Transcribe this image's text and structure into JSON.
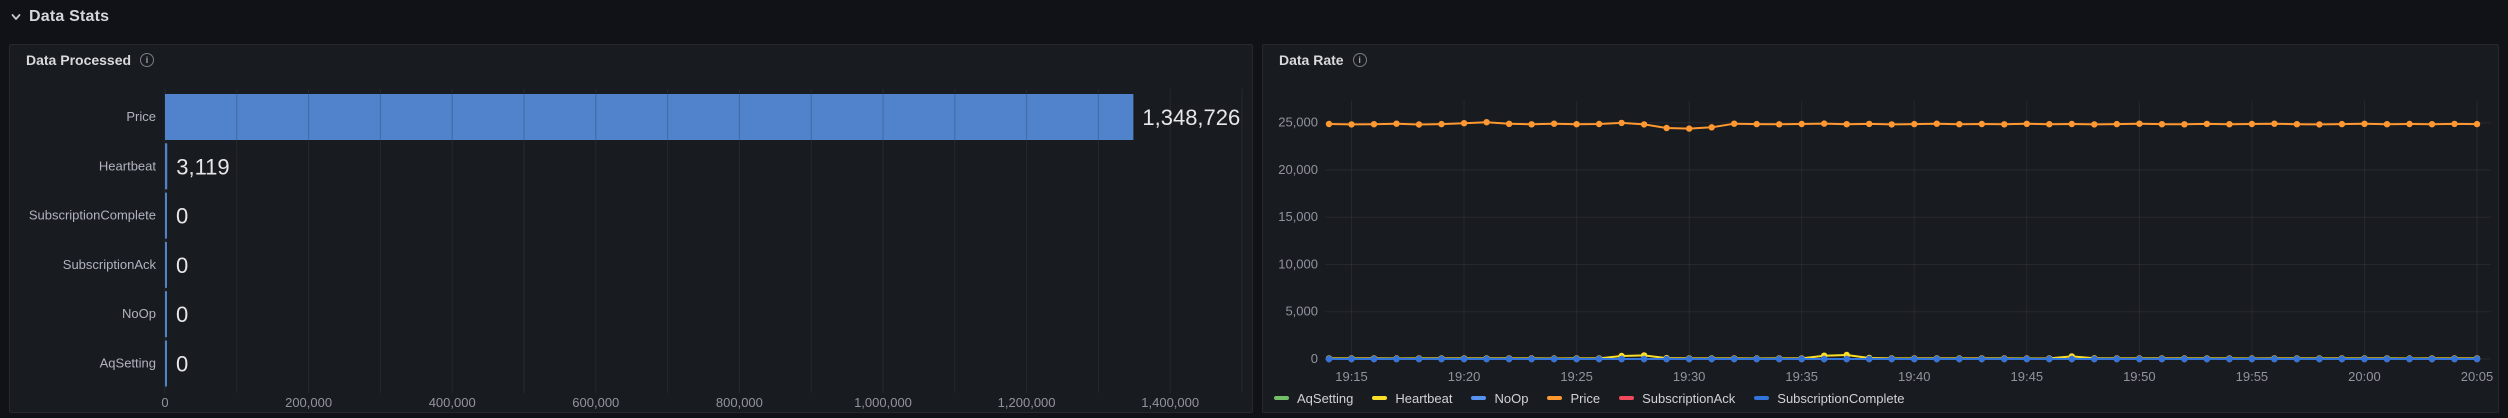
{
  "row_header": {
    "title": "Data Stats"
  },
  "panels": {
    "data_processed": {
      "title": "Data Processed"
    },
    "data_rate": {
      "title": "Data Rate"
    }
  },
  "colors": {
    "page_background": "#111217",
    "panel_background": "#181b1f",
    "panel_border": "#26282e",
    "grid_line": "rgba(204,204,220,0.08)",
    "axis_text": "rgba(204,204,220,0.68)",
    "bar_blue": "#5083cb",
    "value_label": "#e6e7e9"
  },
  "chart_data": [
    {
      "type": "bar",
      "orientation": "horizontal",
      "title": "Data Processed",
      "categories": [
        "Price",
        "Heartbeat",
        "SubscriptionComplete",
        "SubscriptionAck",
        "NoOp",
        "AqSetting"
      ],
      "values": [
        1348726,
        3119,
        0,
        0,
        0,
        0
      ],
      "value_labels": [
        "1,348,726",
        "3,119",
        "0",
        "0",
        "0",
        "0"
      ],
      "bar_color": "#5083cb",
      "xlim": [
        0,
        1500000
      ],
      "grid_step": 100000,
      "x_tick_values": [
        0,
        200000,
        400000,
        600000,
        800000,
        1000000,
        1200000,
        1400000
      ],
      "x_tick_labels": [
        "0",
        "200,000",
        "400,000",
        "600,000",
        "800,000",
        "1,000,000",
        "1,200,000",
        "1,400,000"
      ],
      "legend": "none"
    },
    {
      "type": "line",
      "title": "Data Rate",
      "points_per_series": 52,
      "x_start": "19:14",
      "x_end": "20:05",
      "x_tick_labels": [
        "19:15",
        "19:20",
        "19:25",
        "19:30",
        "19:35",
        "19:40",
        "19:45",
        "19:50",
        "19:55",
        "20:00",
        "20:05"
      ],
      "x_tick_indices": [
        1,
        6,
        11,
        16,
        21,
        26,
        31,
        36,
        41,
        46,
        51
      ],
      "y_tick_values": [
        0,
        5000,
        10000,
        15000,
        20000,
        25000
      ],
      "y_tick_labels": [
        "0",
        "5,000",
        "10,000",
        "15,000",
        "20,000",
        "25,000"
      ],
      "ylim": [
        0,
        27300
      ],
      "legend_position": "bottom",
      "series": [
        {
          "name": "AqSetting",
          "color": "#73BF69",
          "values": [
            0,
            0,
            0,
            0,
            0,
            0,
            0,
            0,
            0,
            0,
            0,
            0,
            0,
            0,
            0,
            0,
            0,
            0,
            0,
            0,
            0,
            0,
            0,
            0,
            0,
            0,
            0,
            0,
            0,
            0,
            0,
            0,
            0,
            0,
            0,
            0,
            0,
            0,
            0,
            0,
            0,
            0,
            0,
            0,
            0,
            0,
            0,
            0,
            0,
            0,
            0,
            0
          ]
        },
        {
          "name": "Heartbeat",
          "color": "#FADE2A",
          "values": [
            60,
            60,
            62,
            58,
            60,
            61,
            59,
            60,
            62,
            60,
            58,
            60,
            61,
            320,
            380,
            90,
            60,
            62,
            60,
            58,
            61,
            60,
            350,
            420,
            110,
            60,
            59,
            61,
            60,
            62,
            60,
            58,
            60,
            280,
            70,
            60,
            61,
            59,
            60,
            62,
            60,
            58,
            61,
            60,
            59,
            60,
            62,
            60,
            58,
            60,
            61,
            60
          ]
        },
        {
          "name": "NoOp",
          "color": "#5794F2",
          "values": [
            0,
            0,
            0,
            0,
            0,
            0,
            0,
            0,
            0,
            0,
            0,
            0,
            0,
            0,
            0,
            0,
            0,
            0,
            0,
            0,
            0,
            0,
            0,
            0,
            0,
            0,
            0,
            0,
            0,
            0,
            0,
            0,
            0,
            0,
            0,
            0,
            0,
            0,
            0,
            0,
            0,
            0,
            0,
            0,
            0,
            0,
            0,
            0,
            0,
            0,
            0,
            0
          ]
        },
        {
          "name": "Price",
          "color": "#FF9830",
          "values": [
            24870,
            24820,
            24850,
            24900,
            24810,
            24860,
            24950,
            25060,
            24890,
            24830,
            24900,
            24840,
            24870,
            24980,
            24820,
            24440,
            24380,
            24520,
            24900,
            24860,
            24830,
            24870,
            24910,
            24850,
            24880,
            24820,
            24860,
            24900,
            24840,
            24870,
            24830,
            24890,
            24850,
            24870,
            24820,
            24860,
            24900,
            24850,
            24830,
            24880,
            24840,
            24870,
            24900,
            24850,
            24820,
            24860,
            24890,
            24840,
            24870,
            24850,
            24880,
            24860
          ]
        },
        {
          "name": "SubscriptionAck",
          "color": "#F2495C",
          "values": [
            0,
            0,
            0,
            0,
            0,
            0,
            0,
            0,
            0,
            0,
            0,
            0,
            0,
            0,
            0,
            0,
            0,
            0,
            0,
            0,
            0,
            0,
            0,
            0,
            0,
            0,
            0,
            0,
            0,
            0,
            0,
            0,
            0,
            0,
            0,
            0,
            0,
            0,
            0,
            0,
            0,
            0,
            0,
            0,
            0,
            0,
            0,
            0,
            0,
            0,
            0,
            0
          ]
        },
        {
          "name": "SubscriptionComplete",
          "color": "#3274D9",
          "values": [
            0,
            0,
            0,
            0,
            0,
            0,
            0,
            0,
            0,
            0,
            0,
            0,
            0,
            0,
            0,
            0,
            0,
            0,
            0,
            0,
            0,
            0,
            0,
            0,
            0,
            0,
            0,
            0,
            0,
            0,
            0,
            0,
            0,
            0,
            0,
            0,
            0,
            0,
            0,
            0,
            0,
            0,
            0,
            0,
            0,
            0,
            0,
            0,
            0,
            0,
            0,
            0
          ]
        }
      ]
    }
  ]
}
